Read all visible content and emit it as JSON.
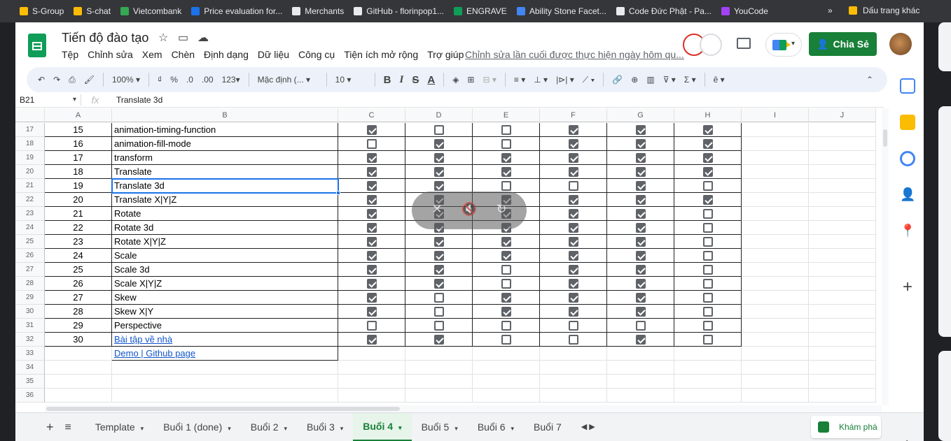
{
  "bookmarks": [
    {
      "label": "S-Group",
      "color": "#fbbc04"
    },
    {
      "label": "S-chat",
      "color": "#fbbc04"
    },
    {
      "label": "Vietcombank",
      "color": "#34a853"
    },
    {
      "label": "Price evaluation for...",
      "color": "#1a73e8"
    },
    {
      "label": "Merchants",
      "color": "#e8eaed"
    },
    {
      "label": "GitHub - florinpop1...",
      "color": "#e8eaed"
    },
    {
      "label": "ENGRAVE",
      "color": "#0f9d58"
    },
    {
      "label": "Ability Stone Facet...",
      "color": "#4285f4"
    },
    {
      "label": "Code Đức Phật - Pa...",
      "color": "#e8eaed"
    },
    {
      "label": "YouCode",
      "color": "#a142f4"
    }
  ],
  "bookmarks_more": "»",
  "bookmarks_other": "Dấu trang khác",
  "doc": {
    "title": "Tiến độ đào tạo",
    "menu": [
      "Tệp",
      "Chỉnh sửa",
      "Xem",
      "Chèn",
      "Định dạng",
      "Dữ liệu",
      "Công cụ",
      "Tiện ích mở rộng",
      "Trợ giúp"
    ],
    "last_edit": "Chỉnh sửa lần cuối được thực hiện ngày hôm qu...",
    "share_label": "Chia Sẻ"
  },
  "toolbar": {
    "zoom": "100%",
    "currency": "₫",
    "percent": "%",
    "dec_less": ".0",
    "dec_more": ".00",
    "number_fmt": "123",
    "font": "Mặc định (...",
    "font_size": "10",
    "bold": "B",
    "italic": "I",
    "strike": "S",
    "text_color": "A",
    "sum": "Σ"
  },
  "formula_bar": {
    "cell_ref": "B21",
    "fx": "fx",
    "content": "Translate 3d"
  },
  "columns": [
    "A",
    "B",
    "C",
    "D",
    "E",
    "F",
    "G",
    "H",
    "I",
    "J"
  ],
  "rows": [
    {
      "n": "17",
      "a": "15",
      "b": "animation-timing-function",
      "c": [
        true,
        false,
        false,
        true,
        true,
        true
      ]
    },
    {
      "n": "18",
      "a": "16",
      "b": "animation-fill-mode",
      "c": [
        false,
        true,
        false,
        true,
        true,
        true
      ]
    },
    {
      "n": "19",
      "a": "17",
      "b": "transform",
      "c": [
        true,
        true,
        true,
        true,
        true,
        true
      ]
    },
    {
      "n": "20",
      "a": "18",
      "b": "Translate",
      "c": [
        true,
        true,
        true,
        true,
        true,
        true
      ]
    },
    {
      "n": "21",
      "a": "19",
      "b": "Translate 3d",
      "c": [
        true,
        true,
        false,
        false,
        true,
        false
      ]
    },
    {
      "n": "22",
      "a": "20",
      "b": "Translate X|Y|Z",
      "c": [
        true,
        true,
        true,
        true,
        true,
        true
      ]
    },
    {
      "n": "23",
      "a": "21",
      "b": "Rotate",
      "c": [
        true,
        true,
        true,
        true,
        true,
        false
      ]
    },
    {
      "n": "24",
      "a": "22",
      "b": "Rotate 3d",
      "c": [
        true,
        true,
        true,
        true,
        true,
        false
      ]
    },
    {
      "n": "25",
      "a": "23",
      "b": "Rotate X|Y|Z",
      "c": [
        true,
        true,
        true,
        true,
        true,
        false
      ]
    },
    {
      "n": "26",
      "a": "24",
      "b": "Scale",
      "c": [
        true,
        true,
        true,
        true,
        true,
        false
      ]
    },
    {
      "n": "27",
      "a": "25",
      "b": "Scale 3d",
      "c": [
        true,
        true,
        false,
        true,
        true,
        false
      ]
    },
    {
      "n": "28",
      "a": "26",
      "b": "Scale X|Y|Z",
      "c": [
        true,
        true,
        false,
        true,
        true,
        false
      ]
    },
    {
      "n": "29",
      "a": "27",
      "b": "Skew",
      "c": [
        true,
        false,
        true,
        true,
        true,
        false
      ]
    },
    {
      "n": "30",
      "a": "28",
      "b": "Skew X|Y",
      "c": [
        true,
        false,
        true,
        true,
        true,
        false
      ]
    },
    {
      "n": "31",
      "a": "29",
      "b": "Perspective",
      "c": [
        false,
        false,
        false,
        false,
        false,
        false
      ]
    },
    {
      "n": "32",
      "a": "30",
      "b": "Bài tập về nhà",
      "link": true,
      "c": [
        true,
        true,
        false,
        false,
        true,
        false
      ]
    },
    {
      "n": "33",
      "a": "",
      "b": "Demo | Github page",
      "link": true,
      "c": null
    },
    {
      "n": "34",
      "a": "",
      "b": "",
      "c": null
    },
    {
      "n": "35",
      "a": "",
      "b": "",
      "c": null
    },
    {
      "n": "36",
      "a": "",
      "b": "",
      "c": null
    }
  ],
  "sheet_tabs": [
    {
      "label": "Template"
    },
    {
      "label": "Buổi 1 (done)"
    },
    {
      "label": "Buổi 2"
    },
    {
      "label": "Buổi 3"
    },
    {
      "label": "Buổi 4",
      "active": true
    },
    {
      "label": "Buổi 5"
    },
    {
      "label": "Buổi 6"
    },
    {
      "label": "Buổi 7"
    }
  ],
  "explore_label": "Khám phá",
  "colors": {
    "green": "#188038",
    "selection": "#1a73e8",
    "link": "#1155cc"
  }
}
